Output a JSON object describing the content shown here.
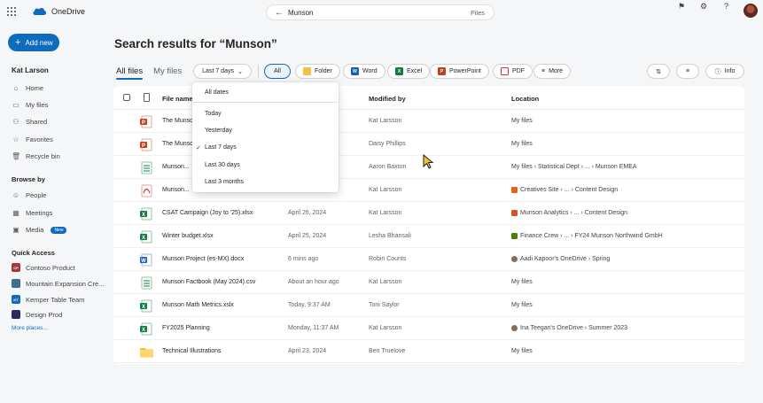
{
  "app": {
    "name": "OneDrive"
  },
  "search": {
    "query": "Munson",
    "scope": "Files"
  },
  "nav": {
    "new_button": "Add new",
    "user": "Kat Larson",
    "items": [
      {
        "label": "Home",
        "icon": "home-icon"
      },
      {
        "label": "My files",
        "icon": "folder-icon"
      },
      {
        "label": "Shared",
        "icon": "people-icon"
      },
      {
        "label": "Favorites",
        "icon": "star-icon"
      },
      {
        "label": "Recycle bin",
        "icon": "trash-icon"
      }
    ],
    "browse_heading": "Browse by",
    "browse": [
      {
        "label": "People",
        "icon": "person-icon"
      },
      {
        "label": "Meetings",
        "icon": "calendar-icon"
      },
      {
        "label": "Media",
        "icon": "image-icon",
        "badge": "New"
      }
    ],
    "quick_heading": "Quick Access",
    "quick": [
      {
        "label": "Contoso Product",
        "abbr": "CP",
        "color": "#a4373a"
      },
      {
        "label": "Mountain Expansion Cre...",
        "abbr": "",
        "color": "#3b6e8f"
      },
      {
        "label": "Kemper Table Team",
        "abbr": "KT",
        "color": "#0f6cbd"
      },
      {
        "label": "Design Prod",
        "abbr": "",
        "color": "#2b2b5c"
      }
    ],
    "more_places": "More places..."
  },
  "main": {
    "title": "Search results for “Munson”",
    "tabs": [
      "All files",
      "My files"
    ],
    "date_filter": "Last 7 days",
    "filters": [
      "All",
      "Folder",
      "Word",
      "Excel",
      "PowerPoint",
      "PDF",
      "More"
    ],
    "info_label": "Info"
  },
  "table": {
    "columns": [
      "File name",
      "Modified by",
      "Location"
    ],
    "rows": [
      {
        "name": "The Munson...",
        "type": "word-ppt",
        "date": "",
        "by": "Kat Larsson",
        "location": "My files",
        "loc_icon": ""
      },
      {
        "name": "The Munson...",
        "type": "ppt",
        "date": "",
        "by": "Daisy Phillips",
        "location": "My files",
        "loc_icon": ""
      },
      {
        "name": "Munson...",
        "type": "csv",
        "date": "",
        "by": "Aaron Baxton",
        "location": "My files › Statistical Dept › ... › Munson EMEA",
        "loc_icon": ""
      },
      {
        "name": "Munson...",
        "type": "pdf",
        "date": "",
        "by": "Kat Larsson",
        "location": "Creatives Site › ... › Content Design",
        "loc_icon": "#e8610c"
      },
      {
        "name": "CSAT Campaign (Joy to '25).xlsx",
        "type": "excel",
        "date": "April 26, 2024",
        "by": "Kat Larsson",
        "location": "Munson Analytics › ... › Content Design",
        "loc_icon": "#d9531e"
      },
      {
        "name": "Winter budget.xlsx",
        "type": "excel",
        "date": "April 25, 2024",
        "by": "Lesha Bhansali",
        "location": "Finance Crew › ... › FY24 Munson Northwind GmbH",
        "loc_icon": "#498205"
      },
      {
        "name": "Munson Project (es-MX).docx",
        "type": "word",
        "date": "6 mins ago",
        "by": "Robin Counts",
        "location": "Aadi Kapoor's OneDrive › Spring",
        "loc_icon": "avatar"
      },
      {
        "name": "Munson Factbook (May 2024).csv",
        "type": "csv",
        "date": "About an hour ago",
        "by": "Kat Larsson",
        "location": "My files",
        "loc_icon": ""
      },
      {
        "name": "Munson Math Metrics.xslx",
        "type": "excel",
        "date": "Today, 9:37 AM",
        "by": "Toni Saylor",
        "location": "My files",
        "loc_icon": ""
      },
      {
        "name": "FY2025 Planning",
        "type": "excel",
        "date": "Monday, 11:37 AM",
        "by": "Kat Larsson",
        "location": "Ina Teegan's OneDrive › Summer 2023",
        "loc_icon": "avatar"
      },
      {
        "name": "Technical Illustrations",
        "type": "folder",
        "date": "April 23, 2024",
        "by": "Ben Truelove",
        "location": "My files",
        "loc_icon": ""
      }
    ]
  },
  "dropdown": {
    "header": "All dates",
    "options": [
      "Today",
      "Yesterday",
      "Last 7 days",
      "Last 30 days",
      "Last 3 months"
    ],
    "selected": "Last 7 days"
  },
  "colors": {
    "accent": "#0f6cbd",
    "word": "#185abd",
    "excel": "#107c41",
    "ppt": "#c43e1c",
    "pdf": "#d13438",
    "folder": "#f5c04a"
  }
}
